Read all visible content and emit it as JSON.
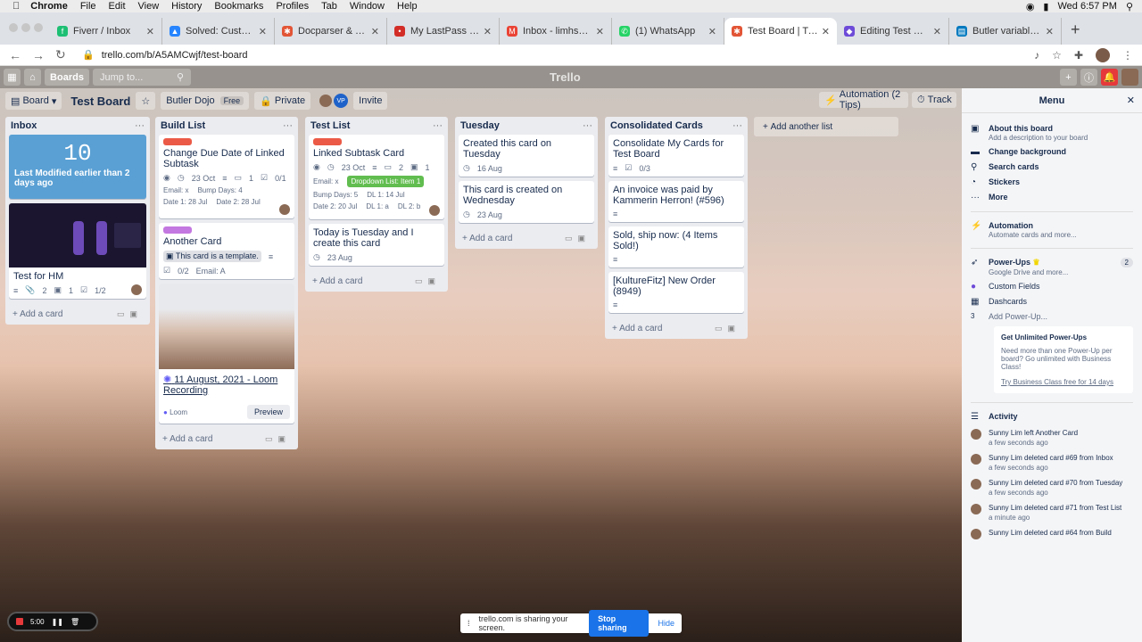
{
  "macbar": {
    "app": "Chrome",
    "menus": [
      "File",
      "Edit",
      "View",
      "History",
      "Bookmarks",
      "Profiles",
      "Tab",
      "Window",
      "Help"
    ],
    "clock": "Wed 6:57 PM"
  },
  "tabs": [
    {
      "title": "Fiverr / Inbox",
      "color": "#1dbf73"
    },
    {
      "title": "Solved: Custom fields",
      "color": "#2684ff"
    },
    {
      "title": "Docparser & Trello int",
      "color": "#e25536"
    },
    {
      "title": "My LastPass Vault",
      "color": "#d32d27"
    },
    {
      "title": "Inbox - limhss@gmail",
      "color": "#ea4335"
    },
    {
      "title": "(1) WhatsApp",
      "color": "#25d366"
    },
    {
      "title": "Test Board | Trello",
      "color": "#e25536"
    },
    {
      "title": "Editing Test Dojo",
      "color": "#6e4bd8"
    },
    {
      "title": "Butler variables - Trel",
      "color": "#0079bf"
    }
  ],
  "address": {
    "url": "trello.com/b/A5AMCwjf/test-board"
  },
  "theader": {
    "boards": "Boards",
    "jump": "Jump to...",
    "logo": "Trello"
  },
  "board": {
    "view": "Board",
    "title": "Test Board",
    "team": "Butler Dojo",
    "team_badge": "Free",
    "privacy": "Private",
    "member_initials": "VP",
    "invite": "Invite",
    "automation": "Automation (2 Tips)",
    "track": "Track",
    "add_list": "Add another list"
  },
  "lists": {
    "inbox": {
      "title": "Inbox",
      "count": "10",
      "count_text": "Last Modified earlier than 2 days ago",
      "card2": "Test for HM",
      "card2_meta": [
        "2",
        "1",
        "1/2"
      ],
      "add": "Add a card"
    },
    "build": {
      "title": "Build List",
      "c1": {
        "title": "Change Due Date of Linked Subtask",
        "date": "23 Oct",
        "comments": "1",
        "check": "0/1",
        "email": "Email: x",
        "bump": "Bump Days: 4",
        "d1": "Date 1: 28 Jul",
        "d2": "Date 2: 28 Jul"
      },
      "c2": {
        "title": "Another Card",
        "template": "This card is a template.",
        "check": "0/2",
        "email": "Email: A"
      },
      "c3": {
        "title": "11 August, 2021 - Loom Recording",
        "source": "Loom",
        "preview": "Preview"
      },
      "add": "Add a card"
    },
    "test": {
      "title": "Test List",
      "c1": {
        "title": "Linked Subtask Card",
        "date": "23 Oct",
        "comments": "2",
        "attach": "1",
        "email": "Email: x",
        "dropdown": "Dropdown List: Item 1",
        "bump": "Bump Days: 5",
        "dl1": "DL 1: 14 Jul",
        "d2": "Date 2: 20 Jul",
        "dl1a": "DL 1: a",
        "dl2": "DL 2: b"
      },
      "c2": {
        "title": "Today is Tuesday and I create this card",
        "date": "23 Aug"
      },
      "add": "Add a card"
    },
    "tuesday": {
      "title": "Tuesday",
      "c1": {
        "title": "Created this card on Tuesday",
        "date": "16 Aug"
      },
      "c2": {
        "title": "This card is created on Wednesday",
        "date": "23 Aug"
      },
      "add": "Add a card"
    },
    "consolidated": {
      "title": "Consolidated Cards",
      "c1": {
        "title": "Consolidate My Cards for Test Board",
        "check": "0/3"
      },
      "c2": {
        "title": "An invoice was paid by Kammerin Herron! (#596)"
      },
      "c3": {
        "title": "Sold, ship now: (4 Items Sold!)"
      },
      "c4": {
        "title": "[KultureFitz] New Order (8949)"
      },
      "add": "Add a card"
    }
  },
  "menu": {
    "title": "Menu",
    "about": "About this board",
    "about_sub": "Add a description to your board",
    "bg": "Change background",
    "search": "Search cards",
    "stickers": "Stickers",
    "more": "More",
    "auto": "Automation",
    "auto_sub": "Automate cards and more...",
    "power": "Power-Ups",
    "power_count": "2",
    "power_sub": "Google Drive and more...",
    "cf": "Custom Fields",
    "dash": "Dashcards",
    "add_pu": "Add Power-Up...",
    "add_pu_num": "3",
    "promo_title": "Get Unlimited Power-Ups",
    "promo_text": "Need more than one Power-Up per board? Go unlimited with Business Class!",
    "promo_link": "Try Business Class free for 14 days",
    "activity": "Activity",
    "acts": [
      {
        "text": "Sunny Lim left Another Card",
        "when": "a few seconds ago"
      },
      {
        "text": "Sunny Lim deleted card #69 from Inbox",
        "when": "a few seconds ago"
      },
      {
        "text": "Sunny Lim deleted card #70 from Tuesday",
        "when": "a few seconds ago"
      },
      {
        "text": "Sunny Lim deleted card #71 from Test List",
        "when": "a minute ago"
      },
      {
        "text": "Sunny Lim deleted card #64 from Build",
        "when": ""
      }
    ]
  },
  "recorder": {
    "time": "5:00"
  },
  "share": {
    "text": "trello.com is sharing your screen.",
    "stop": "Stop sharing",
    "hide": "Hide"
  }
}
